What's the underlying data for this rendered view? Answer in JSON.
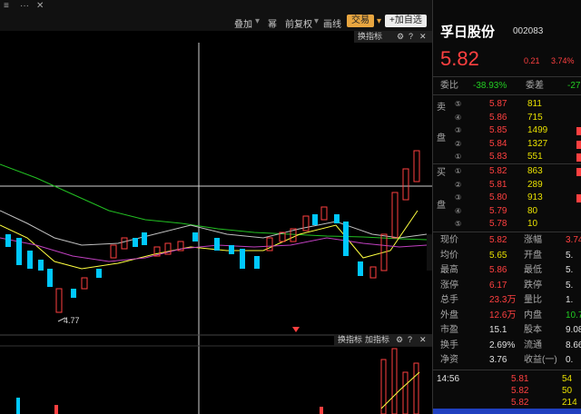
{
  "toolbar": {
    "overlay": "叠加",
    "adjust": "前复权",
    "draw": "画线",
    "trade": "交易",
    "add_fav": "+加自选",
    "ind_switch": "换指标",
    "ind_add": "加指标"
  },
  "chart": {
    "low_label": "4.77"
  },
  "quote": {
    "name": "孚日股份",
    "code": "002083",
    "price": "5.82",
    "change": "0.21",
    "change_pct": "3.74%",
    "weibi_label": "委比",
    "weibi_value": "-38.93%",
    "weicha_label": "委差",
    "weicha_value": "-27",
    "sell_label_1": "卖",
    "sell_label_2": "盘",
    "buy_label_1": "买",
    "buy_label_2": "盘",
    "asks": [
      {
        "level": "⑤",
        "price": "5.87",
        "vol": "811"
      },
      {
        "level": "④",
        "price": "5.86",
        "vol": "715"
      },
      {
        "level": "③",
        "price": "5.85",
        "vol": "1499"
      },
      {
        "level": "②",
        "price": "5.84",
        "vol": "1327"
      },
      {
        "level": "①",
        "price": "5.83",
        "vol": "551"
      }
    ],
    "bids": [
      {
        "level": "①",
        "price": "5.82",
        "vol": "863"
      },
      {
        "level": "②",
        "price": "5.81",
        "vol": "289"
      },
      {
        "level": "③",
        "price": "5.80",
        "vol": "913"
      },
      {
        "level": "④",
        "price": "5.79",
        "vol": "80"
      },
      {
        "level": "⑤",
        "price": "5.78",
        "vol": "10"
      }
    ],
    "stats": [
      {
        "l1": "现价",
        "v1": "5.82",
        "l2": "涨幅",
        "v2": "3.74"
      },
      {
        "l1": "均价",
        "v1": "5.65",
        "l2": "开盘",
        "v2": "5."
      },
      {
        "l1": "最高",
        "v1": "5.86",
        "l2": "最低",
        "v2": "5."
      },
      {
        "l1": "涨停",
        "v1": "6.17",
        "l2": "跌停",
        "v2": "5."
      },
      {
        "l1": "总手",
        "v1": "23.3万",
        "l2": "量比",
        "v2": "1."
      },
      {
        "l1": "外盘",
        "v1": "12.6万",
        "l2": "内盘",
        "v2": "10.7"
      },
      {
        "l1": "市盈",
        "v1": "15.1",
        "l2": "股本",
        "v2": "9.08"
      },
      {
        "l1": "换手",
        "v1": "2.69%",
        "l2": "流通",
        "v2": "8.66"
      },
      {
        "l1": "净资",
        "v1": "3.76",
        "l2": "收益(一)",
        "v2": "0."
      }
    ],
    "ticks": [
      {
        "time": "14:56",
        "price": "5.81",
        "vol": "54"
      },
      {
        "time": "",
        "price": "5.82",
        "vol": "50"
      },
      {
        "time": "",
        "price": "5.82",
        "vol": "214"
      }
    ]
  }
}
